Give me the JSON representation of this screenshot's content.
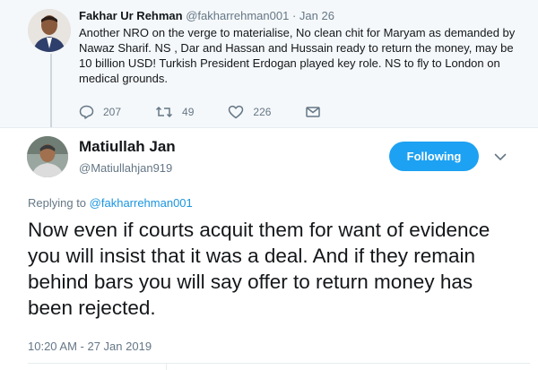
{
  "parent_tweet": {
    "author_name": "Fakhar Ur Rehman",
    "author_handle": "@fakharrehman001",
    "separator": "·",
    "date": "Jan 26",
    "text": "Another NRO on the verge to materialise, No clean chit for Maryam as demanded by Nawaz Sharif. NS , Dar and Hassan and Hussain ready to return the money, may be 10 billion USD! Turkish President Erdogan played key role. NS to fly to London on medical grounds.",
    "actions": {
      "reply_icon": "reply-icon",
      "reply_count": "207",
      "retweet_icon": "retweet-icon",
      "retweet_count": "49",
      "like_icon": "heart-icon",
      "like_count": "226",
      "dm_icon": "envelope-icon"
    }
  },
  "main_tweet": {
    "author_name": "Matiullah Jan",
    "author_handle": "@Matiullahjan919",
    "follow_label": "Following",
    "more_icon": "chevron-down-icon",
    "replying_prefix": "Replying to",
    "replying_to": "@fakharrehman001",
    "text": "Now even if courts acquit them for want of evidence you will insist that it was a deal. And if they remain behind bars you will say offer to return money has been rejected.",
    "timestamp": "10:20 AM - 27 Jan 2019"
  },
  "colors": {
    "accent": "#1da1f2",
    "link": "#1b95e0",
    "muted_text": "#657786",
    "parent_bg": "#f5f8fa"
  }
}
